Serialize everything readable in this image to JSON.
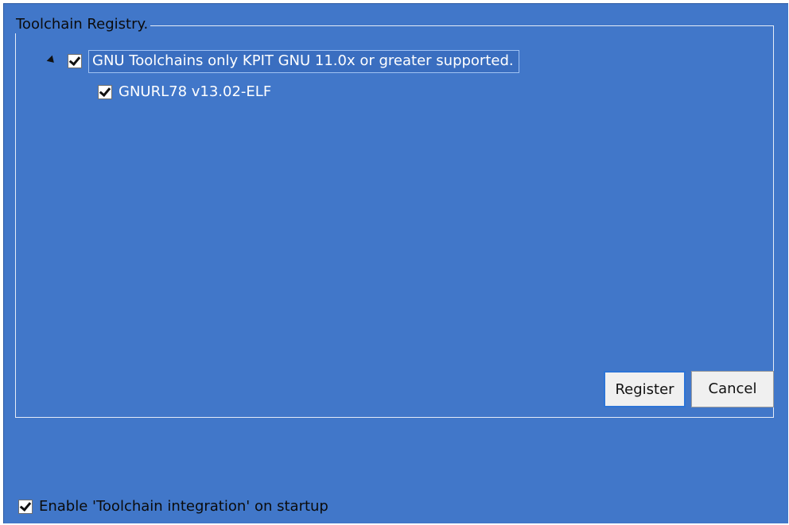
{
  "group": {
    "title": "Toolchain Registry."
  },
  "tree": {
    "root": {
      "label": "GNU Toolchains only KPIT GNU 11.0x or greater supported.",
      "checked": true,
      "expanded": true
    },
    "children": [
      {
        "label": "GNURL78 v13.02-ELF",
        "checked": true
      }
    ]
  },
  "buttons": {
    "register": "Register",
    "cancel": "Cancel"
  },
  "startup": {
    "label": "Enable 'Toolchain integration' on startup",
    "checked": true
  },
  "colors": {
    "panel_background": "#4177c9",
    "selection_border": "#9fc1f2",
    "default_button_border": "#2d74d6"
  }
}
